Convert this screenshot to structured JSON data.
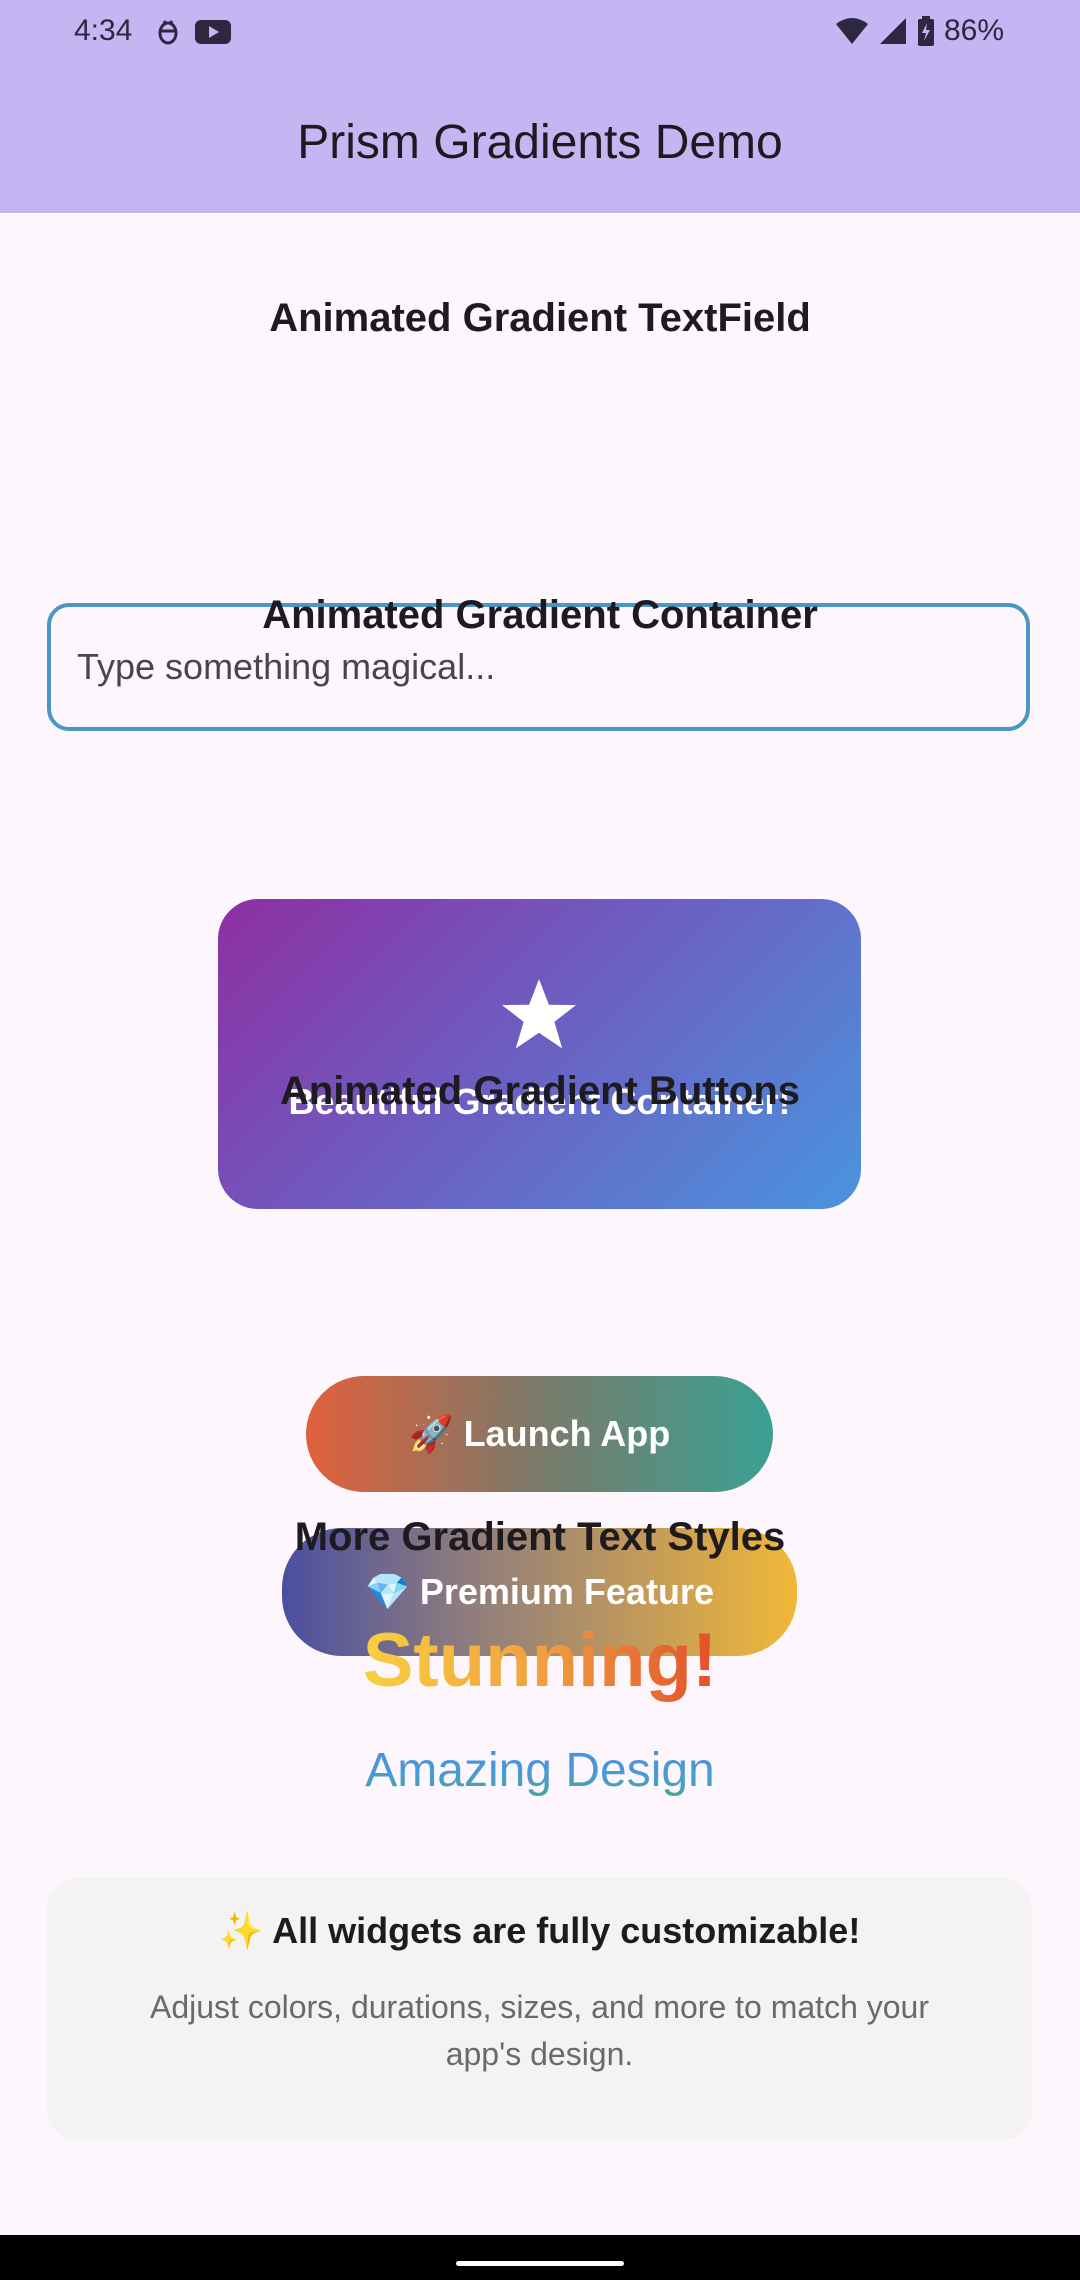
{
  "status_bar": {
    "time": "4:34",
    "battery": "86%",
    "left_icons": [
      "debug-icon",
      "youtube-icon"
    ],
    "right_icons": [
      "wifi-icon",
      "signal-icon",
      "battery-charging-icon"
    ]
  },
  "app_bar": {
    "title": "Prism Gradients Demo"
  },
  "sections": {
    "textfield_title": "Animated Gradient TextField",
    "container_title": "Animated Gradient Container",
    "buttons_title": "Animated Gradient Buttons",
    "text_styles_title": "More Gradient Text Styles"
  },
  "text_field": {
    "placeholder": "Type something magical...",
    "value": "",
    "border_color": "#4a97c2"
  },
  "gradient_container": {
    "icon": "star-icon",
    "text": "Beautiful Gradient Container!",
    "colors": [
      "#8e2fa2",
      "#4a94de"
    ]
  },
  "buttons": {
    "launch": {
      "emoji": "🚀",
      "label": "Launch App",
      "colors": [
        "#e1603c",
        "#3aa193"
      ]
    },
    "premium": {
      "emoji": "💎",
      "label": "Premium Feature",
      "colors": [
        "#4b4ea2",
        "#f0b838"
      ]
    }
  },
  "gradient_texts": {
    "stunning": "Stunning!",
    "amazing": "Amazing Design"
  },
  "info_card": {
    "emoji": "✨",
    "title": "All widgets are fully customizable!",
    "text": "Adjust colors, durations, sizes, and more to match your app's design."
  },
  "colors": {
    "app_bar": "#c4b5f3",
    "background": "#fdf7fd",
    "card": "#f3f3f3"
  }
}
